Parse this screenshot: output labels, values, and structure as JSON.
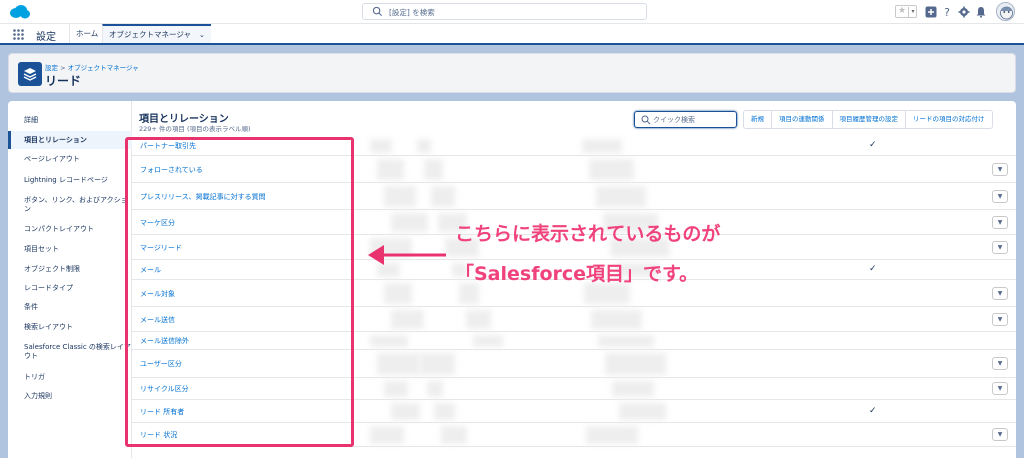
{
  "header": {
    "search_placeholder": "[設定] を検索",
    "fav_star": "★",
    "fav_caret": "▾"
  },
  "nav": {
    "app_name": "設定",
    "tabs": [
      {
        "label": "ホーム"
      },
      {
        "label": "オブジェクトマネージャ"
      }
    ],
    "tab_chevron": "⌄"
  },
  "page_header": {
    "breadcrumb_root": "設定",
    "breadcrumb_sep": " > ",
    "breadcrumb_current": "オブジェクトマネージャ",
    "title": "リード"
  },
  "sidebar": {
    "items": [
      {
        "label": "詳細"
      },
      {
        "label": "項目とリレーション"
      },
      {
        "label": "ページレイアウト"
      },
      {
        "label": "Lightning レコードページ"
      },
      {
        "label": "ボタン、リンク、およびアクション"
      },
      {
        "label": "コンパクトレイアウト"
      },
      {
        "label": "項目セット"
      },
      {
        "label": "オブジェクト制限"
      },
      {
        "label": "レコードタイプ"
      },
      {
        "label": "条件"
      },
      {
        "label": "検索レイアウト"
      },
      {
        "label": "Salesforce Classic の検索レイアウト"
      },
      {
        "label": "トリガ"
      },
      {
        "label": "入力規則"
      }
    ]
  },
  "section": {
    "title": "項目とリレーション",
    "subtitle": "229+ 件の項目 (項目の表示ラベル順)",
    "quick_search_placeholder": "クイック検索",
    "buttons": [
      {
        "label": "新規"
      },
      {
        "label": "項目の連動関係"
      },
      {
        "label": "項目履歴管理の設定"
      },
      {
        "label": "リードの項目の対応付け"
      }
    ]
  },
  "fields": [
    {
      "label": "パートナー取引先",
      "check": "✓",
      "dropdown": ""
    },
    {
      "label": "フォローされている",
      "check": "",
      "dropdown": "▼"
    },
    {
      "label": "プレスリリース、掲載記事に対する質問",
      "check": "",
      "dropdown": "▼"
    },
    {
      "label": "マーケ区分",
      "check": "",
      "dropdown": "▼"
    },
    {
      "label": "マージリード",
      "check": "",
      "dropdown": "▼"
    },
    {
      "label": "メール",
      "check": "✓",
      "dropdown": ""
    },
    {
      "label": "メール対象",
      "check": "",
      "dropdown": "▼"
    },
    {
      "label": "メール送信",
      "check": "",
      "dropdown": "▼"
    },
    {
      "label": "メール送信除外",
      "check": "",
      "dropdown": ""
    },
    {
      "label": "ユーザー区分",
      "check": "",
      "dropdown": "▼"
    },
    {
      "label": "リサイクル区分",
      "check": "",
      "dropdown": "▼"
    },
    {
      "label": "リード 所有者",
      "check": "✓",
      "dropdown": ""
    },
    {
      "label": "リード 状況",
      "check": "",
      "dropdown": "▼"
    }
  ],
  "annotation": {
    "line1": "こちらに表示されているものが",
    "line2": "「Salesforce項目」です。",
    "color": "#f0437c"
  }
}
